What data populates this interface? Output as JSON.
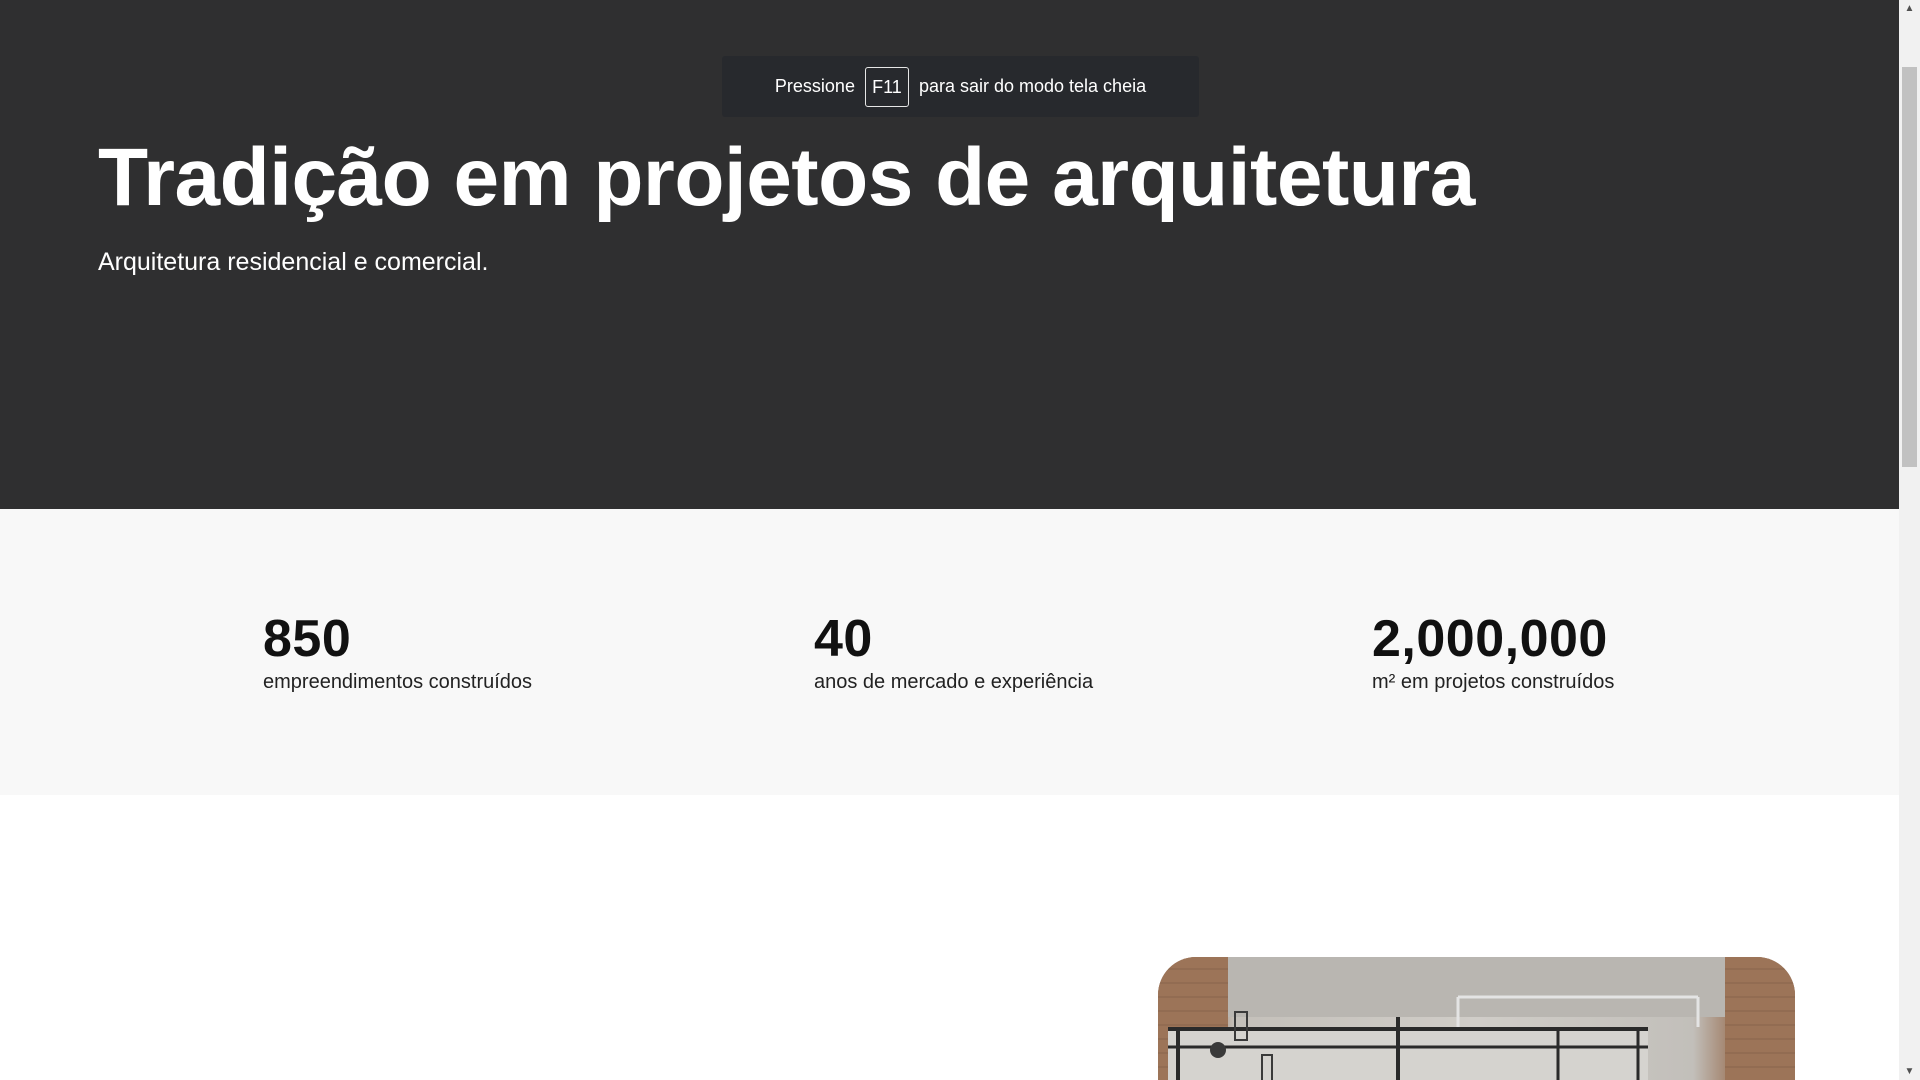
{
  "fullscreen_notice": {
    "prefix": "Pressione",
    "key": "F11",
    "suffix": "para sair do modo tela cheia"
  },
  "hero": {
    "title": "Tradição em projetos de arquitetura",
    "subtitle": "Arquitetura residencial e comercial."
  },
  "stats": [
    {
      "value": "850",
      "label": "empreendimentos construídos"
    },
    {
      "value": "40",
      "label": "anos de mercado e experiência"
    },
    {
      "value": "2,000,000",
      "label": "m² em projetos construídos"
    }
  ],
  "scrollbar": {
    "up_icon": "triangle-up",
    "down_icon": "triangle-down",
    "up_glyph": "▲",
    "down_glyph": "▼"
  },
  "colors": {
    "hero_bg": "#2f2f30",
    "stats_bg": "#f8f8f8",
    "toast_bg": "#27292d"
  }
}
